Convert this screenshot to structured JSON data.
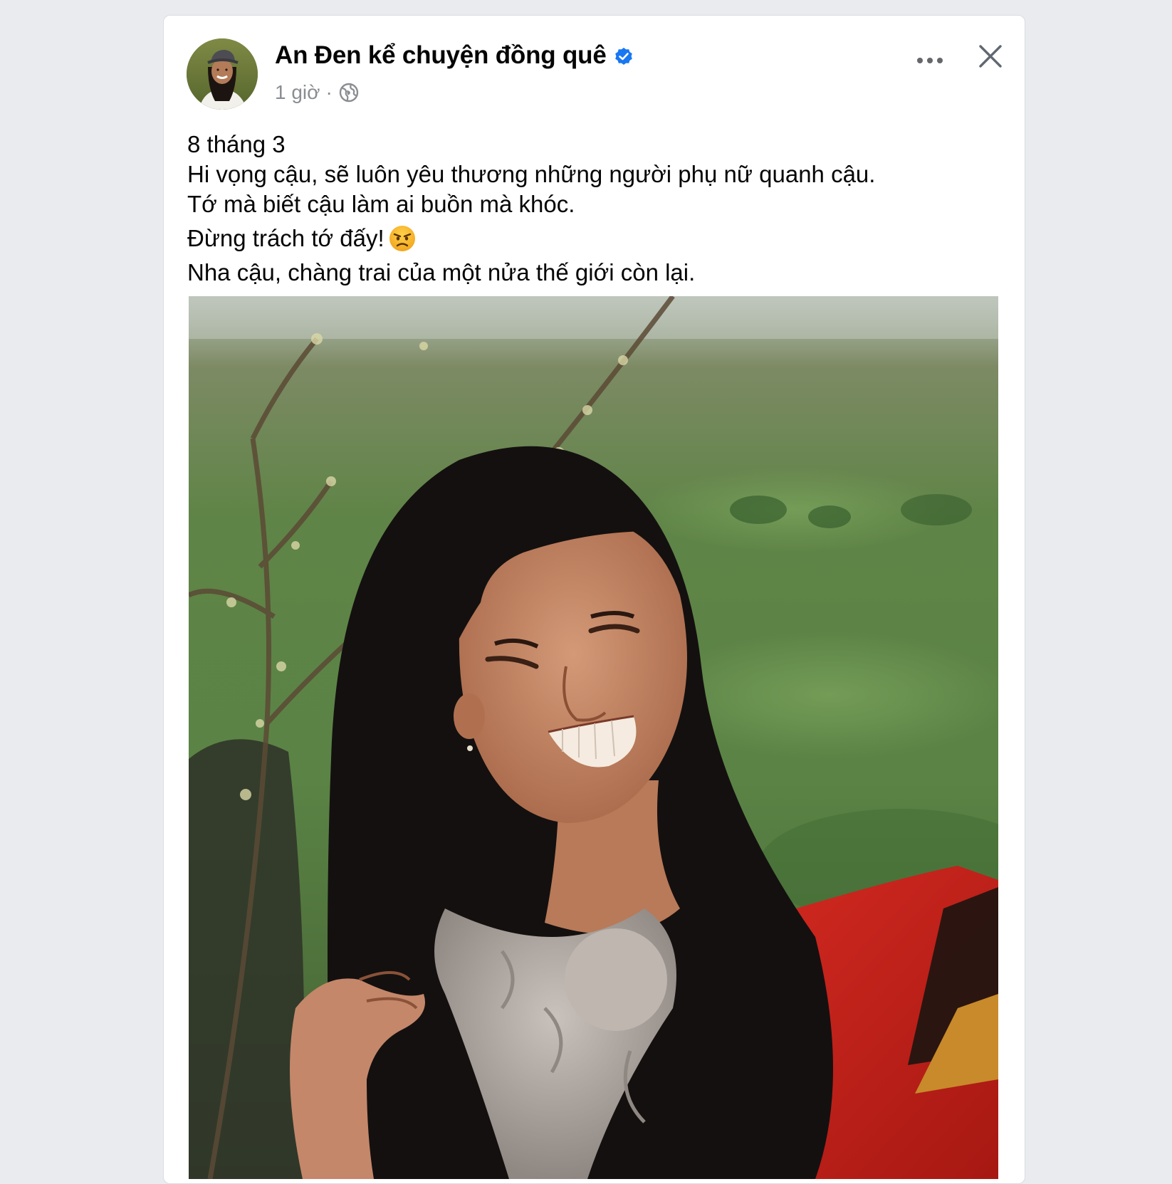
{
  "post": {
    "author": "An Đen kể chuyện đồng quê",
    "time": "1 giờ",
    "separator": "·",
    "lines": [
      "8 tháng 3",
      "Hi vọng cậu, sẽ luôn yêu thương những người phụ nữ quanh cậu.",
      "Tớ mà biết cậu làm ai buồn mà khóc.",
      "Đừng trách tớ đấy!",
      "Nha cậu, chàng trai của một nửa thế giới còn lại."
    ]
  },
  "icons": {
    "verified": "verified-badge-icon",
    "audience": "globe-icon",
    "more": "more-options-icon",
    "close": "close-icon",
    "emoji": "angry-face-emoji"
  },
  "colors": {
    "verified": "#1877f2",
    "text": "#050505",
    "meta": "#8a8d91",
    "background": "#e9ebee",
    "card": "#ffffff"
  }
}
